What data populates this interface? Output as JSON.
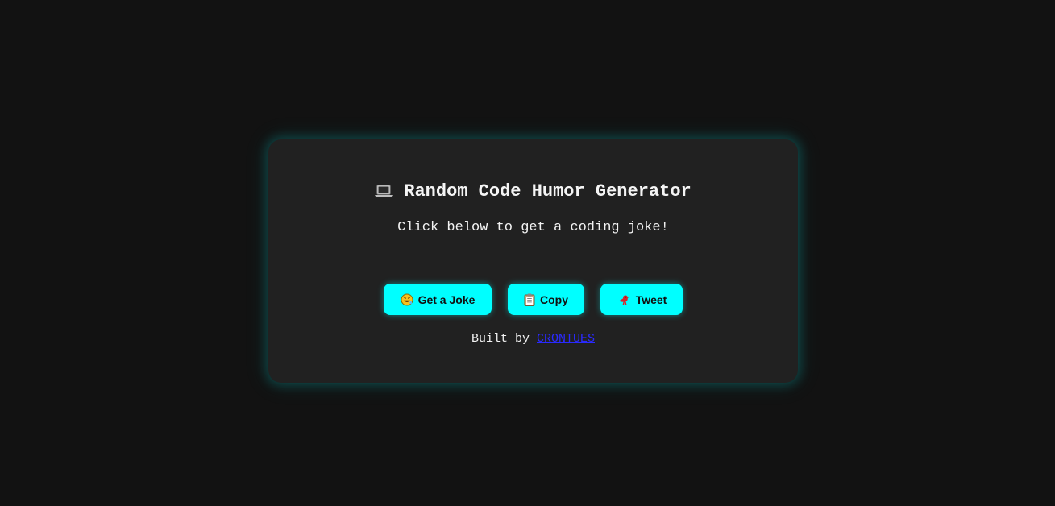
{
  "header": {
    "icon": "laptop-icon",
    "title": "Random Code Humor Generator",
    "subtitle": "Click below to get a coding joke!"
  },
  "actions": {
    "joke": {
      "icon": "rofl-emoji-icon",
      "label": "Get a Joke"
    },
    "copy": {
      "icon": "clipboard-icon",
      "label": "Copy"
    },
    "tweet": {
      "icon": "bird-icon",
      "label": "Tweet"
    }
  },
  "footer": {
    "prefix": "Built by ",
    "author": "CRONTUES"
  },
  "colors": {
    "background": "#121212",
    "card": "#212121",
    "accent": "#00ffff",
    "link": "#2a2aff",
    "text": "#f2f2f2"
  }
}
